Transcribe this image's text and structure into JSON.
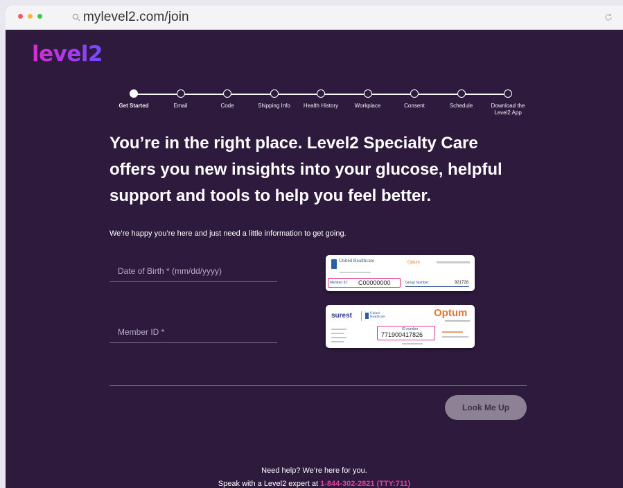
{
  "browser": {
    "url": "mylevel2.com/join",
    "traffic_colors": [
      "#f25d56",
      "#f6bd3b",
      "#3ec84a"
    ]
  },
  "brand": {
    "logo_text": "level2"
  },
  "stepper": {
    "steps": [
      {
        "label": "Get Started",
        "active": true
      },
      {
        "label": "Email",
        "active": false
      },
      {
        "label": "Code",
        "active": false
      },
      {
        "label": "Shipping Info",
        "active": false
      },
      {
        "label": "Health History",
        "active": false
      },
      {
        "label": "Workplace",
        "active": false
      },
      {
        "label": "Consent",
        "active": false
      },
      {
        "label": "Schedule",
        "active": false
      },
      {
        "label": "Download the Level2 App",
        "active": false
      }
    ]
  },
  "main": {
    "headline_lines": [
      "You’re in the right place. Level2 Specialty Care",
      "offers you new insights into your glucose, helpful",
      "support and tools to help you feel better."
    ],
    "intro": "We’re happy you’re here and just need a little information to get going."
  },
  "form": {
    "dob_placeholder": "Date of Birth * (mm/dd/yyyy)",
    "member_id_placeholder": "Member ID *",
    "lookup_label": "Look Me Up"
  },
  "cards": {
    "uhc": {
      "brand": "United Healthcare",
      "partner": "Optum",
      "member_label": "Member ID:",
      "member_id": "C00000000",
      "group_label": "Group Number:",
      "group_number": "921728"
    },
    "surest": {
      "brand": "surest",
      "partner_brand": "United Healthcare",
      "optum": "Optum",
      "id_label": "ID number",
      "id_number": "771900417826"
    }
  },
  "help": {
    "line1": "Need help? We’re here for you.",
    "line2_prefix": "Speak with a Level2 expert at ",
    "phone": "1-844-302-2821 (TTY:711)"
  },
  "colors": {
    "page_bg": "#2d1a3d",
    "accent_pink": "#e3419f",
    "button_bg": "#8d8195"
  }
}
